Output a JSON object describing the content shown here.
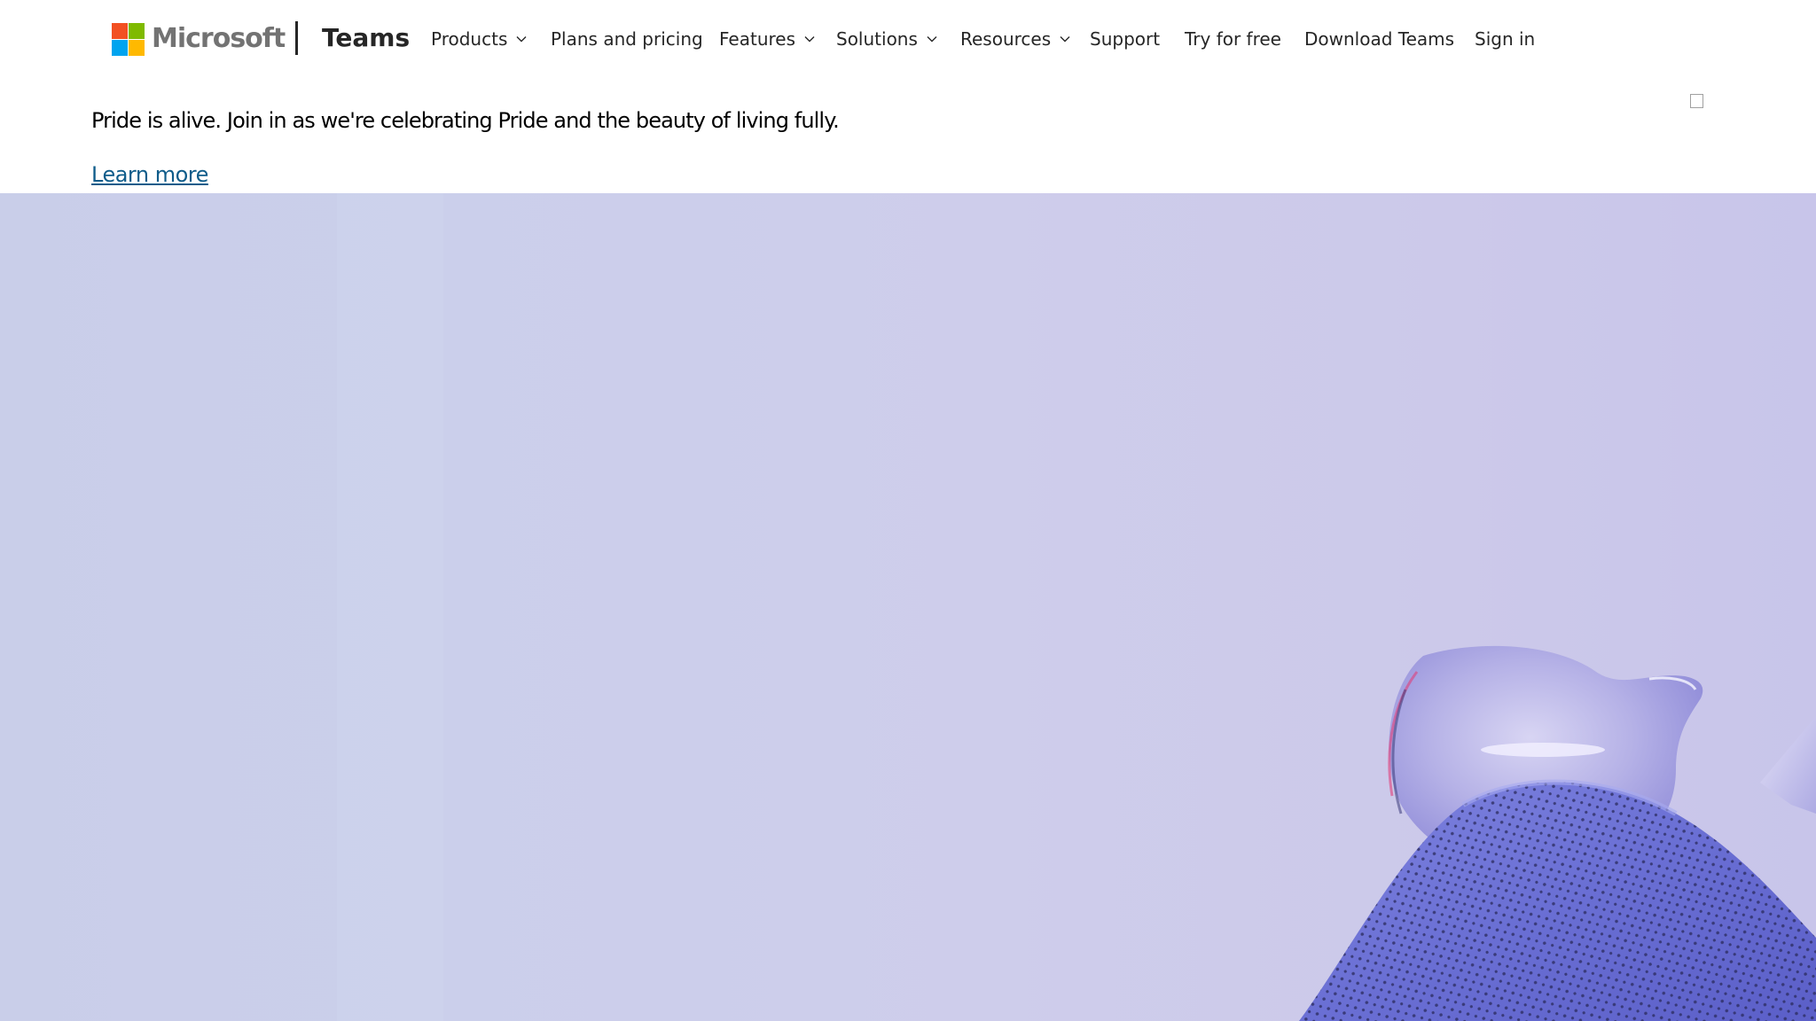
{
  "brand": {
    "company": "Microsoft",
    "product": "Teams",
    "logo_colors": [
      "#f25022",
      "#7fba00",
      "#00a4ef",
      "#ffb900"
    ]
  },
  "nav": {
    "products": "Products",
    "plans": "Plans and pricing",
    "features": "Features",
    "solutions": "Solutions",
    "resources": "Resources",
    "support": "Support",
    "try_free": "Try for free",
    "download": "Download Teams",
    "sign_in": "Sign in"
  },
  "banner": {
    "message": "Pride is alive. Join in as we're celebrating Pride and the beauty of living fully.",
    "link_label": "Learn more"
  },
  "hero": {
    "background_color": "#ccccea",
    "accent_color": "#6b6fd6"
  }
}
